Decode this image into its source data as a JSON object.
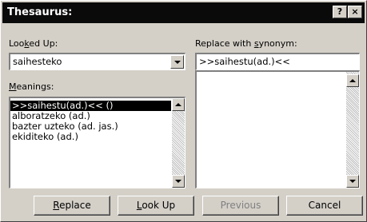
{
  "window": {
    "title": "Thesaurus:",
    "help_glyph": "?",
    "close_glyph": "×"
  },
  "looked_up": {
    "label_pre": "Loo",
    "label_key": "k",
    "label_post": "ed Up:",
    "value": "saihesteko"
  },
  "meanings": {
    "label_key": "M",
    "label_post": "eanings:",
    "items": [
      ">>saihestu(ad.)<< ()",
      "alboratzeko (ad.)",
      "bazter uzteko (ad. jas.)",
      "ekiditeko (ad.)"
    ],
    "selected_index": 0
  },
  "replace": {
    "label_pre": "Replace with ",
    "label_key": "s",
    "label_post": "ynonym:",
    "value": ">>saihestu(ad.)<<"
  },
  "buttons": {
    "replace": {
      "key": "R",
      "rest": "eplace"
    },
    "lookup": {
      "key": "L",
      "rest": "ook Up"
    },
    "previous": {
      "label": "Previous"
    },
    "cancel": {
      "label": "Cancel"
    }
  }
}
